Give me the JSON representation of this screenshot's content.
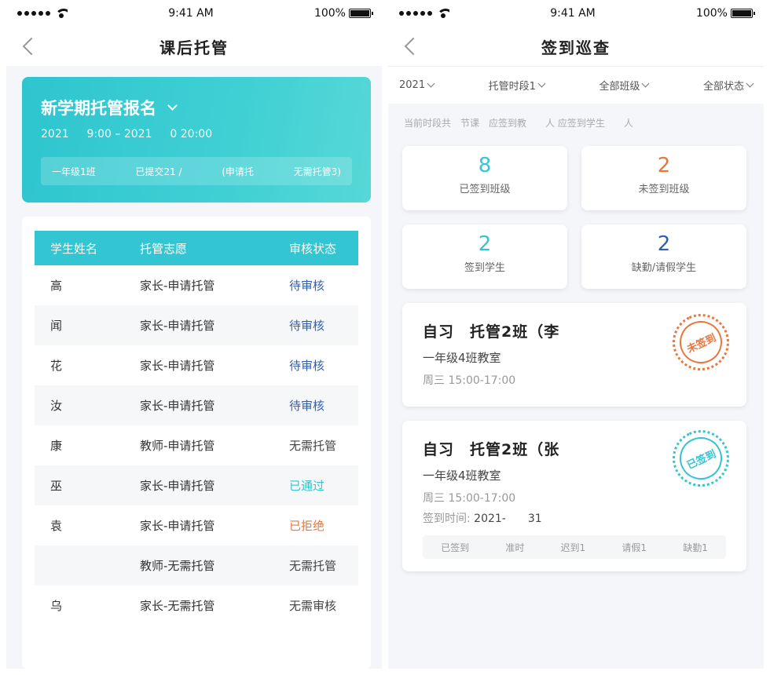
{
  "status_bar": {
    "time": "9:41 AM",
    "battery": "100%"
  },
  "left": {
    "nav_title": "课后托管",
    "banner": {
      "title": "新学期托管报名",
      "time_range": "2021 　 9:00 – 2021 　 0 20:00",
      "stats": [
        "一年级1班",
        "已提交21 /",
        "(申请托",
        "无需托管3)"
      ]
    },
    "table": {
      "headers": [
        "学生姓名",
        "托管志愿",
        "审核状态"
      ],
      "rows": [
        {
          "name": "高",
          "choice": "家长-申请托管",
          "status": "待审核",
          "status_type": "pending"
        },
        {
          "name": "闻",
          "choice": "家长-申请托管",
          "status": "待审核",
          "status_type": "pending"
        },
        {
          "name": "花",
          "choice": "家长-申请托管",
          "status": "待审核",
          "status_type": "pending"
        },
        {
          "name": "汝",
          "choice": "家长-申请托管",
          "status": "待审核",
          "status_type": "pending"
        },
        {
          "name": "康",
          "choice": "教师-申请托管",
          "status": "无需托管",
          "status_type": "none"
        },
        {
          "name": "巫",
          "choice": "家长-申请托管",
          "status": "已通过",
          "status_type": "pass"
        },
        {
          "name": "袁",
          "choice": "家长-申请托管",
          "status": "已拒绝",
          "status_type": "reject"
        },
        {
          "name": "",
          "choice": "教师-无需托管",
          "status": "无需托管",
          "status_type": "none"
        },
        {
          "name": "乌",
          "choice": "家长-无需托管",
          "status": "无需审核",
          "status_type": "none"
        }
      ]
    }
  },
  "right": {
    "nav_title": "签到巡查",
    "filters": [
      "2021",
      "托管时段1",
      "全部班级",
      "全部状态"
    ],
    "summary": "当前时段共　节课　应签到教　　人 应签到学生　　人",
    "stats": [
      {
        "value": "8",
        "label": "已签到班级",
        "color": "teal"
      },
      {
        "value": "2",
        "label": "未签到班级",
        "color": "orange"
      },
      {
        "value": "2",
        "label": "签到学生",
        "color": "teal"
      },
      {
        "value": "2",
        "label": "缺勤/请假学生",
        "color": "blue"
      }
    ],
    "courses": [
      {
        "title": "自习　托管2班（李",
        "room": "一年级4班教室",
        "time": "周三  15:00-17:00",
        "stamp": "未签到"
      },
      {
        "title": "自习　托管2班（张",
        "room": "一年级4班教室",
        "time": "周三  15:00-17:00",
        "checkin_label": "签到时间:",
        "checkin_value": "2021-　　31",
        "counts": [
          "已签到",
          "准时",
          "迟到1",
          "请假1",
          "缺勤1"
        ],
        "stamp": "已签到"
      }
    ]
  }
}
